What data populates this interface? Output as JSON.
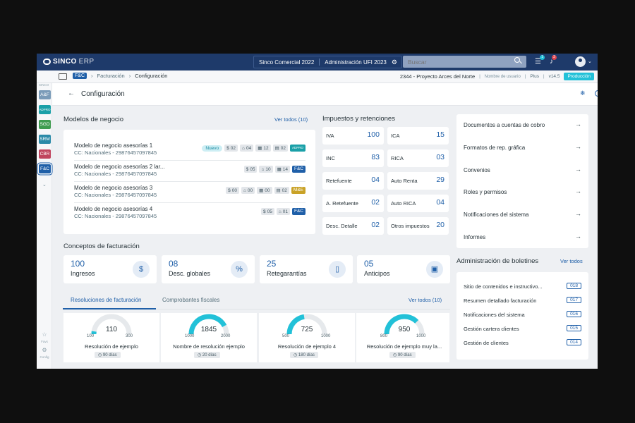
{
  "app": {
    "logo_main": "SINCO",
    "logo_sub": "ERP"
  },
  "topbar": {
    "company": "Sinco Comercial 2022",
    "admin": "Administración UFI 2023",
    "search_placeholder": "Buscar",
    "tasks_badge": "1",
    "alerts_badge": "3"
  },
  "subbar": {
    "module_tag": "F&C",
    "crumb1": "Facturación",
    "crumb2": "Configuración",
    "project": "2344 - Proyecto Arces del Norte",
    "user": "Nombre de usuario",
    "plan": "Plus",
    "version": "v14.5",
    "env": "Producción"
  },
  "rail": {
    "brand": "SINCO",
    "modules": [
      {
        "label": "A&F",
        "color": "#7a9bb8"
      },
      {
        "label": "ADPRO",
        "color": "#1aa0a8"
      },
      {
        "label": "SGD",
        "color": "#3e9b4f"
      },
      {
        "label": "SRM",
        "color": "#2a8aa8"
      },
      {
        "label": "CBR",
        "color": "#c0455e"
      },
      {
        "label": "F&C",
        "color": "#1f5fa8"
      }
    ],
    "fav_label": "Favs",
    "config_label": "Config"
  },
  "page": {
    "title": "Configuración"
  },
  "modelos": {
    "title": "Modelos de negocio",
    "ver_todos": "Ver todos (10)",
    "rows": [
      {
        "name": "Modelo de negocio asesorías 1",
        "cc": "CC: Nacionales - 29876457097845",
        "nuevo": "Nuevo",
        "c1": "02",
        "c2": "04",
        "c3": "12",
        "c4": "02",
        "tag": "ADPRO",
        "tag_color": "#1aa0a8"
      },
      {
        "name": "Modelo de negocio asesorías 2 lar...",
        "cc": "CC: Nacionales - 29876457097845",
        "c1": "05",
        "c2": "10",
        "c3": "14",
        "tag": "F&C",
        "tag_color": "#1f5fa8"
      },
      {
        "name": "Modelo de negocio asesorías 3",
        "cc": "CC: Nacionales - 29876457097845",
        "c1": "00",
        "c2": "00",
        "c3": "00",
        "c4": "02",
        "tag": "M&E",
        "tag_color": "#c9a227"
      },
      {
        "name": "Modelo de negocio asesorías 4",
        "cc": "CC: Nacionales - 29876457097845",
        "c1": "05",
        "c2": "01",
        "tag": "F&C",
        "tag_color": "#1f5fa8"
      }
    ]
  },
  "impuestos": {
    "title": "Impuestos y retenciones",
    "items": [
      {
        "label": "IVA",
        "value": "100"
      },
      {
        "label": "ICA",
        "value": "15"
      },
      {
        "label": "INC",
        "value": "83"
      },
      {
        "label": "RICA",
        "value": "03"
      },
      {
        "label": "Retefuente",
        "value": "04"
      },
      {
        "label": "Auto Renta",
        "value": "29"
      },
      {
        "label": "A. Retefuente",
        "value": "02"
      },
      {
        "label": "Auto RICA",
        "value": "04"
      },
      {
        "label": "Desc. Detalle",
        "value": "02"
      },
      {
        "label": "Otros impuestos",
        "value": "20"
      }
    ]
  },
  "right_links": [
    "Documentos a cuentas de cobro",
    "Formatos de rep. gráfica",
    "Convenios",
    "Roles y permisos",
    "Notificaciones del sistema",
    "Informes"
  ],
  "boletines": {
    "title": "Administración de boletines",
    "ver_todos": "Ver todos",
    "items": [
      {
        "label": "Sitio de contenidos e instructivo...",
        "num": "018"
      },
      {
        "label": "Resumen detallado facturación",
        "num": "017"
      },
      {
        "label": "Notificaciones del sistema",
        "num": "016"
      },
      {
        "label": "Gestión cartera clientes",
        "num": "015"
      },
      {
        "label": "Gestión de clientes",
        "num": "014"
      }
    ]
  },
  "conceptos": {
    "title": "Conceptos de facturación",
    "items": [
      {
        "num": "100",
        "label": "Ingresos",
        "icon": "dollar-coin-icon"
      },
      {
        "num": "08",
        "label": "Desc. globales",
        "icon": "discount-tag-icon"
      },
      {
        "num": "25",
        "label": "Retegarantías",
        "icon": "clipboard-icon"
      },
      {
        "num": "05",
        "label": "Anticipos",
        "icon": "archive-box-icon"
      }
    ]
  },
  "tabs": {
    "active": "Resoluciones de facturación",
    "other": "Comprobantes fiscales",
    "ver_todos": "Ver todos (10)"
  },
  "resoluciones": [
    {
      "value": "110",
      "min": "100",
      "max": "300",
      "fraction": 0.05,
      "name": "Resolución de ejemplo",
      "dias": "90 días"
    },
    {
      "value": "1845",
      "min": "1000",
      "max": "2000",
      "fraction": 0.845,
      "name": "Nombre de resolución ejemplo",
      "dias": "20 días"
    },
    {
      "value": "725",
      "min": "500",
      "max": "1000",
      "fraction": 0.45,
      "name": "Resolución de ejemplo 4",
      "dias": "180 días"
    },
    {
      "value": "950",
      "min": "800",
      "max": "1000",
      "fraction": 0.75,
      "name": "Resolución de ejemplo muy la...",
      "dias": "90 días"
    }
  ],
  "colors": {
    "primary": "#1f5fa8",
    "navy": "#1e3a6a",
    "accent": "#22c1d8"
  }
}
